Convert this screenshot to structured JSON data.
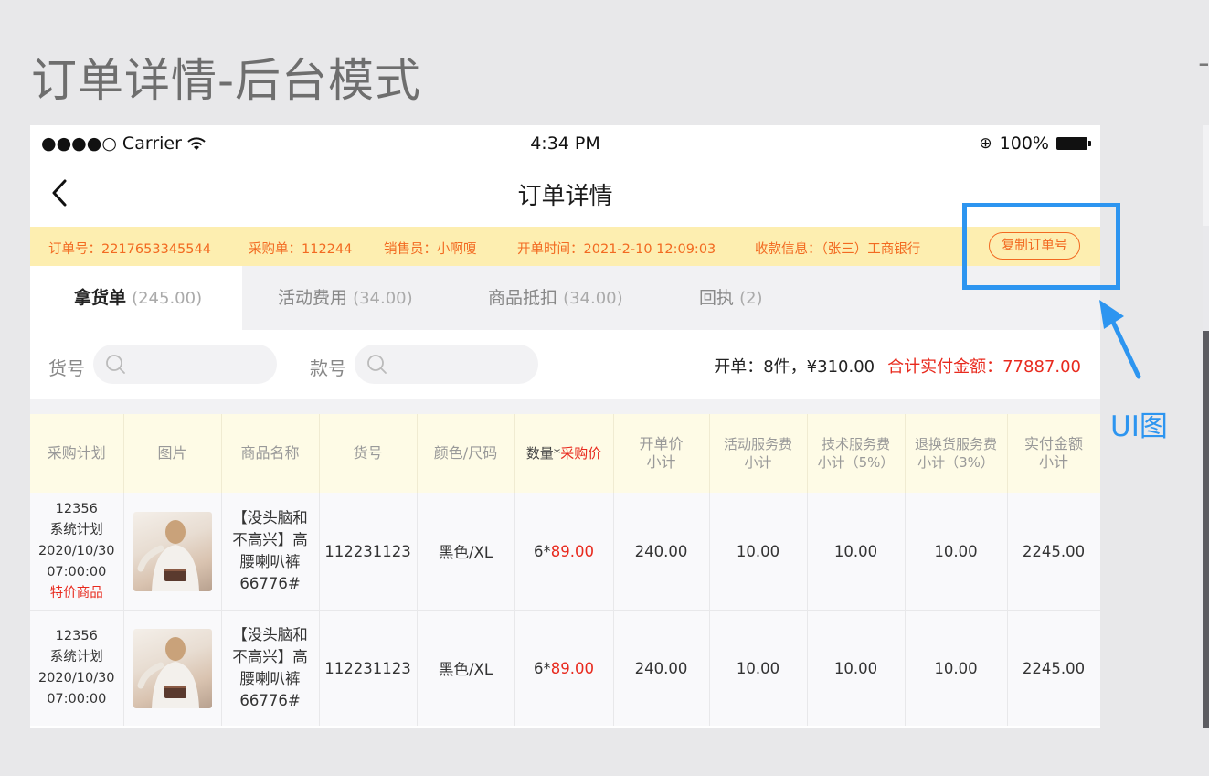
{
  "page_title": "订单详情-后台模式",
  "status_bar": {
    "carrier": "●●●●○ Carrier",
    "time": "4:34 PM",
    "battery": "100%"
  },
  "nav": {
    "title": "订单详情"
  },
  "info_bar": {
    "order_no": "订单号：2217653345544",
    "purchase_no": "采购单：112244",
    "seller": "销售员：小啊嗄",
    "open_time": "开单时间：2021-2-10 12:09:03",
    "payee": "收款信息：（张三）工商银行",
    "copy_label": "复制订单号"
  },
  "tabs": [
    {
      "label": "拿货单",
      "count": "(245.00)"
    },
    {
      "label": "活动费用",
      "count": "(34.00)"
    },
    {
      "label": "商品抵扣",
      "count": "(34.00)"
    },
    {
      "label": "回执",
      "count": "(2)"
    }
  ],
  "filter": {
    "item_no_label": "货号",
    "style_no_label": "款号",
    "summary": "开单：8件，¥310.00",
    "total": "合计实付金额：77887.00"
  },
  "table": {
    "headers": {
      "plan": "采购计划",
      "image": "图片",
      "name": "商品名称",
      "item_no": "货号",
      "color_size": "颜色/尺码",
      "qty": "数量*",
      "qty_red": "采购价",
      "open_price_1": "开单价",
      "open_price_2": "小计",
      "activity_fee_1": "活动服务费",
      "activity_fee_2": "小计",
      "tech_fee_1": "技术服务费",
      "tech_fee_2": "小计（5%）",
      "return_fee_1": "退换货服务费",
      "return_fee_2": "小计（3%）",
      "paid_1": "实付金额",
      "paid_2": "小计"
    },
    "rows": [
      {
        "plan_no": "12356",
        "plan_type": "系统计划",
        "plan_date": "2020/10/30",
        "plan_time": "07:00:00",
        "tag": "特价商品",
        "name": "【没头脑和不高兴】高腰喇叭裤66776#",
        "item_no": "112231123",
        "color_size": "黑色/XL",
        "qty": "6*",
        "price": "89.00",
        "open_price": "240.00",
        "activity_fee": "10.00",
        "tech_fee": "10.00",
        "return_fee": "10.00",
        "paid": "2245.00"
      },
      {
        "plan_no": "12356",
        "plan_type": "系统计划",
        "plan_date": "2020/10/30",
        "plan_time": "07:00:00",
        "tag": "",
        "name": "【没头脑和不高兴】高腰喇叭裤66776#",
        "item_no": "112231123",
        "color_size": "黑色/XL",
        "qty": "6*",
        "price": "89.00",
        "open_price": "240.00",
        "activity_fee": "10.00",
        "tech_fee": "10.00",
        "return_fee": "10.00",
        "paid": "2245.00"
      }
    ]
  },
  "annotation": {
    "label": "UI图",
    "color": "#2d95f0"
  },
  "colors": {
    "accent_orange": "#f26a21",
    "price_red": "#e82a1e",
    "info_bg": "#fdeeb0"
  }
}
